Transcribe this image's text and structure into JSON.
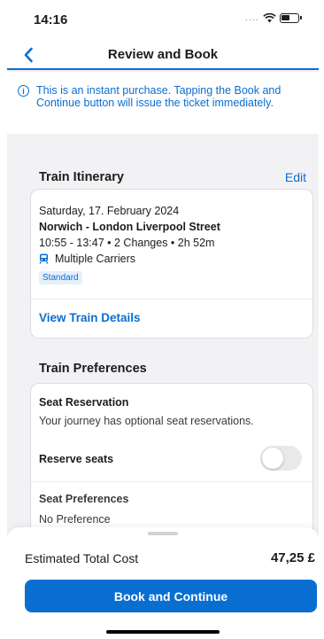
{
  "status_bar": {
    "time": "14:16",
    "signal": "....",
    "icons": [
      "wifi-icon",
      "battery-icon"
    ]
  },
  "nav": {
    "title": "Review and Book",
    "back_icon": "chevron-left-icon"
  },
  "info_banner": {
    "icon": "info-icon",
    "text": "This is an instant purchase. Tapping the Book and Continue button will issue the ticket immediately."
  },
  "itinerary": {
    "section_title": "Train Itinerary",
    "edit_label": "Edit",
    "date": "Saturday, 17. February 2024",
    "route": "Norwich - London Liverpool Street",
    "times": "10:55 - 13:47 • 2 Changes • 2h 52m",
    "carrier_icon": "train-icon",
    "carrier": "Multiple Carriers",
    "class_badge": "Standard",
    "view_details": "View Train Details"
  },
  "preferences": {
    "section_title": "Train Preferences",
    "seat_reservation_title": "Seat Reservation",
    "seat_reservation_desc": "Your journey has optional seat reservations.",
    "reserve_label": "Reserve seats",
    "reserve_on": false,
    "seat_pref_title": "Seat Preferences",
    "seat_pref_value": "No Preference"
  },
  "footer": {
    "cost_label": "Estimated Total Cost",
    "cost_value": "47,25 £",
    "book_button": "Book and Continue"
  },
  "colors": {
    "accent": "#0a6ed1",
    "background": "#f2f2f4"
  }
}
